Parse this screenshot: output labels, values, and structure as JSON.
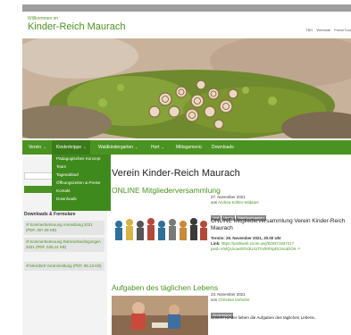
{
  "header": {
    "welcome": "Willkommen im",
    "site_name": "Kinder-Reich Maurach",
    "links": [
      "TBG",
      "Webmail",
      "Portal Tool"
    ]
  },
  "nav": {
    "items": [
      {
        "label": "Verein",
        "has_dropdown": true
      },
      {
        "label": "Kinderkrippe",
        "has_dropdown": true
      },
      {
        "label": "Waldkindergarten",
        "has_dropdown": true
      },
      {
        "label": "Hort",
        "has_dropdown": true
      },
      {
        "label": "Mittagsmenü",
        "has_dropdown": false
      },
      {
        "label": "Downloads",
        "has_dropdown": false
      }
    ],
    "active_index": 1
  },
  "dropdown": {
    "items": [
      "Pädagogisches Konzept",
      "Team",
      "Tagesablauf",
      "Öffnungszeiten & Preise",
      "Kontakt",
      "Downloads"
    ]
  },
  "sidebar": {
    "downloads_title": "Downloads & Formulare",
    "downloads": [
      "Sommerbetreuung Anmeldung 2021 (PDF, 397.28 KB)",
      "Sommerbetreuung Rahmenbedingungen 2021 (PDF, 535.14 KB)",
      "Messbett Voranmeldung (PDF, 85.13 KB)"
    ]
  },
  "main": {
    "page_title": "Verein Kinder-Reich Maurach",
    "posts": [
      {
        "title": "ONLINE Mitgliederversammlung",
        "date": "27. November 2021",
        "author_prefix": "von",
        "author": "Andrea Köhler-Widauer",
        "tags": [
          "Hort",
          "Verein",
          "Waldkindergarten"
        ],
        "text": "ONLINE Mitgliederversammlung Verein Kinder-Reich Maurach",
        "termin_label": "Termin:",
        "termin_value": "29. November 2021, 20.00 Uhr",
        "link_label": "Link:",
        "link_value": "https://us05web.zoom.us/j/81937193721?",
        "link_value2": "pwd=VmlQU1owOGs3U41TnVERXpDc2VodzO9"
      },
      {
        "title": "Aufgaben des täglichen Lebens",
        "date": "23. November 2021",
        "author_prefix": "von",
        "author": "Christina Vorhofer",
        "tags": [
          "Kinderkrippe"
        ],
        "excerpt": "Unsere Kinder lieben die Aufgaben des täglichen Lebens.."
      }
    ]
  },
  "colors": {
    "brand_green": "#4a9322",
    "dropdown_green": "#3f8a1c",
    "tag_gray": "#8b8b8b"
  }
}
